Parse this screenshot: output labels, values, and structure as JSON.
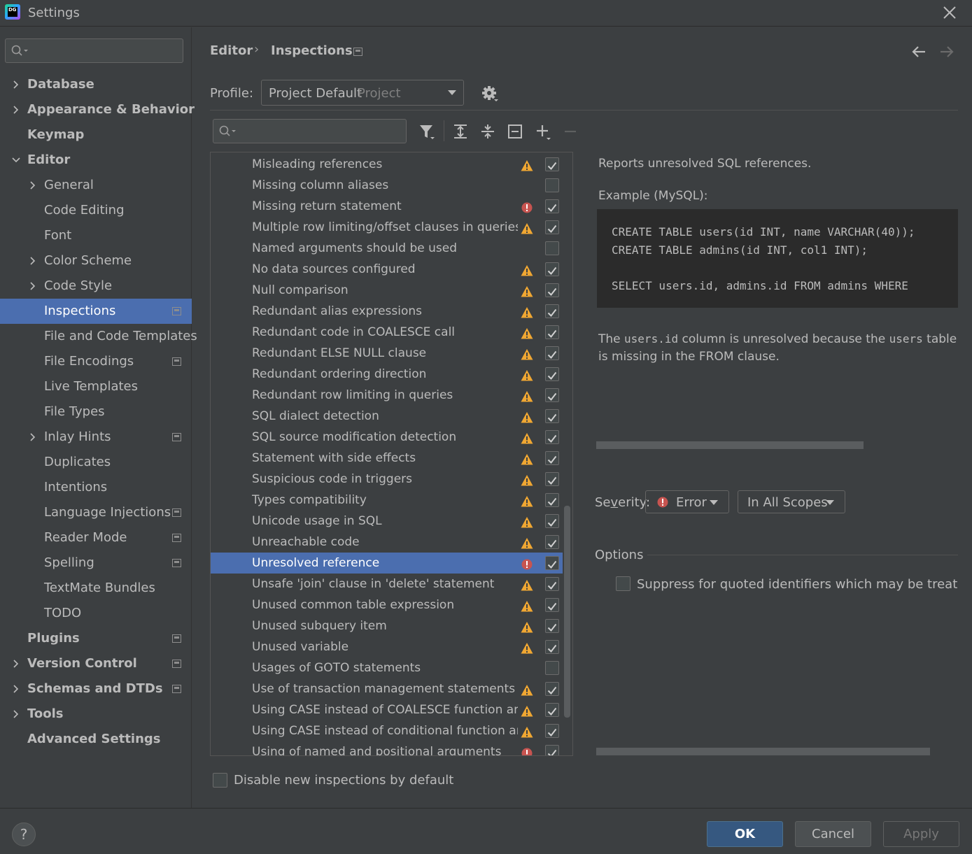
{
  "window": {
    "title": "Settings",
    "logo_text": "DG"
  },
  "sidebar": {
    "items": [
      {
        "label": "Database",
        "level": 0,
        "bold": true,
        "chevron": "right",
        "proj": false
      },
      {
        "label": "Appearance & Behavior",
        "level": 0,
        "bold": true,
        "chevron": "right",
        "proj": false
      },
      {
        "label": "Keymap",
        "level": 0,
        "bold": true,
        "chevron": "none",
        "proj": false
      },
      {
        "label": "Editor",
        "level": 0,
        "bold": true,
        "chevron": "down",
        "proj": false
      },
      {
        "label": "General",
        "level": 1,
        "bold": false,
        "chevron": "right",
        "proj": false
      },
      {
        "label": "Code Editing",
        "level": 1,
        "bold": false,
        "chevron": "none",
        "proj": false
      },
      {
        "label": "Font",
        "level": 1,
        "bold": false,
        "chevron": "none",
        "proj": false
      },
      {
        "label": "Color Scheme",
        "level": 1,
        "bold": false,
        "chevron": "right",
        "proj": false
      },
      {
        "label": "Code Style",
        "level": 1,
        "bold": false,
        "chevron": "right",
        "proj": false
      },
      {
        "label": "Inspections",
        "level": 1,
        "bold": false,
        "chevron": "none",
        "proj": true,
        "selected": true
      },
      {
        "label": "File and Code Templates",
        "level": 1,
        "bold": false,
        "chevron": "none",
        "proj": false
      },
      {
        "label": "File Encodings",
        "level": 1,
        "bold": false,
        "chevron": "none",
        "proj": true
      },
      {
        "label": "Live Templates",
        "level": 1,
        "bold": false,
        "chevron": "none",
        "proj": false
      },
      {
        "label": "File Types",
        "level": 1,
        "bold": false,
        "chevron": "none",
        "proj": false
      },
      {
        "label": "Inlay Hints",
        "level": 1,
        "bold": false,
        "chevron": "right",
        "proj": true
      },
      {
        "label": "Duplicates",
        "level": 1,
        "bold": false,
        "chevron": "none",
        "proj": false
      },
      {
        "label": "Intentions",
        "level": 1,
        "bold": false,
        "chevron": "none",
        "proj": false
      },
      {
        "label": "Language Injections",
        "level": 1,
        "bold": false,
        "chevron": "none",
        "proj": true
      },
      {
        "label": "Reader Mode",
        "level": 1,
        "bold": false,
        "chevron": "none",
        "proj": true
      },
      {
        "label": "Spelling",
        "level": 1,
        "bold": false,
        "chevron": "none",
        "proj": true
      },
      {
        "label": "TextMate Bundles",
        "level": 1,
        "bold": false,
        "chevron": "none",
        "proj": false
      },
      {
        "label": "TODO",
        "level": 1,
        "bold": false,
        "chevron": "none",
        "proj": false
      },
      {
        "label": "Plugins",
        "level": 0,
        "bold": true,
        "chevron": "none",
        "proj": true
      },
      {
        "label": "Version Control",
        "level": 0,
        "bold": true,
        "chevron": "right",
        "proj": true
      },
      {
        "label": "Schemas and DTDs",
        "level": 0,
        "bold": true,
        "chevron": "right",
        "proj": true
      },
      {
        "label": "Tools",
        "level": 0,
        "bold": true,
        "chevron": "right",
        "proj": false
      },
      {
        "label": "Advanced Settings",
        "level": 0,
        "bold": true,
        "chevron": "none",
        "proj": false
      }
    ]
  },
  "header": {
    "breadcrumb": [
      "Editor",
      "Inspections"
    ],
    "separator": "›"
  },
  "profile": {
    "label": "Profile:",
    "value": "Project Default",
    "scope": "Project"
  },
  "inspections": [
    {
      "name": "Misleading references",
      "severity": "warning",
      "checked": true
    },
    {
      "name": "Missing column aliases",
      "severity": "none",
      "checked": false
    },
    {
      "name": "Missing return statement",
      "severity": "error",
      "checked": true
    },
    {
      "name": "Multiple row limiting/offset clauses in queries",
      "severity": "warning",
      "checked": true
    },
    {
      "name": "Named arguments should be used",
      "severity": "none",
      "checked": false
    },
    {
      "name": "No data sources configured",
      "severity": "warning",
      "checked": true
    },
    {
      "name": "Null comparison",
      "severity": "warning",
      "checked": true
    },
    {
      "name": "Redundant alias expressions",
      "severity": "warning",
      "checked": true
    },
    {
      "name": "Redundant code in COALESCE call",
      "severity": "warning",
      "checked": true
    },
    {
      "name": "Redundant ELSE NULL clause",
      "severity": "warning",
      "checked": true
    },
    {
      "name": "Redundant ordering direction",
      "severity": "warning",
      "checked": true
    },
    {
      "name": "Redundant row limiting in queries",
      "severity": "warning",
      "checked": true
    },
    {
      "name": "SQL dialect detection",
      "severity": "warning",
      "checked": true
    },
    {
      "name": "SQL source modification detection",
      "severity": "warning",
      "checked": true
    },
    {
      "name": "Statement with side effects",
      "severity": "warning",
      "checked": true
    },
    {
      "name": "Suspicious code in triggers",
      "severity": "warning",
      "checked": true
    },
    {
      "name": "Types compatibility",
      "severity": "warning",
      "checked": true
    },
    {
      "name": "Unicode usage in SQL",
      "severity": "warning",
      "checked": true
    },
    {
      "name": "Unreachable code",
      "severity": "warning",
      "checked": true
    },
    {
      "name": "Unresolved reference",
      "severity": "error",
      "checked": true,
      "selected": true
    },
    {
      "name": "Unsafe 'join' clause in 'delete' statement",
      "severity": "warning",
      "checked": true
    },
    {
      "name": "Unused common table expression",
      "severity": "warning",
      "checked": true
    },
    {
      "name": "Unused subquery item",
      "severity": "warning",
      "checked": true
    },
    {
      "name": "Unused variable",
      "severity": "warning",
      "checked": true
    },
    {
      "name": "Usages of GOTO statements",
      "severity": "none",
      "checked": false
    },
    {
      "name": "Use of transaction management statements in tr",
      "severity": "warning",
      "checked": true
    },
    {
      "name": "Using CASE instead of COALESCE function and v",
      "severity": "warning",
      "checked": true
    },
    {
      "name": "Using CASE instead of conditional function and",
      "severity": "warning",
      "checked": true
    },
    {
      "name": "Using of named and positional arguments",
      "severity": "error",
      "checked": true
    }
  ],
  "disable_new": {
    "label": "Disable new inspections by default",
    "checked": false
  },
  "description": {
    "summary": "Reports unresolved SQL references.",
    "example_label": "Example (MySQL):",
    "code_lines": [
      "CREATE TABLE users(id INT, name VARCHAR(40));",
      "CREATE TABLE admins(id INT, col1 INT);",
      "",
      "SELECT users.id, admins.id FROM admins WHERE"
    ],
    "text_parts": [
      {
        "t": "The ",
        "mono": false
      },
      {
        "t": "users.id",
        "mono": true
      },
      {
        "t": " column is unresolved because the ",
        "mono": false
      },
      {
        "t": "users",
        "mono": true
      },
      {
        "t": " table is missing in the FROM clause.",
        "mono": false
      }
    ]
  },
  "severity": {
    "label_pre": "Se",
    "label_mn": "v",
    "label_post": "erity:",
    "value": "Error",
    "scope": "In All Scopes"
  },
  "options": {
    "title": "Options",
    "suppress_label": "Suppress for quoted identifiers which may be treated as st",
    "suppress_checked": false
  },
  "buttons": {
    "help": "?",
    "ok": "OK",
    "cancel": "Cancel",
    "apply": "Apply"
  },
  "colors": {
    "accent": "#4b6eaf",
    "warning": "#f0a732",
    "error": "#c75450",
    "ok_button": "#365880"
  }
}
